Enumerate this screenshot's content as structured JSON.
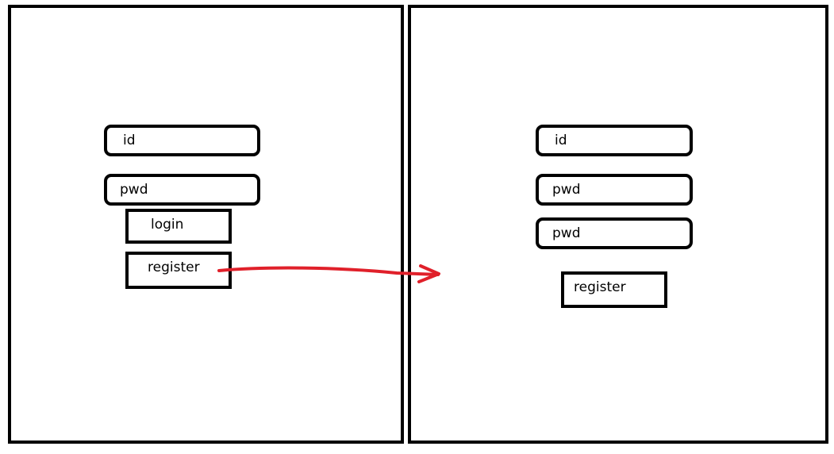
{
  "login_screen": {
    "id_field": "id",
    "pwd_field": "pwd",
    "login_button": "login",
    "register_button": "register"
  },
  "register_screen": {
    "id_field": "id",
    "pwd_field": "pwd",
    "pwd_confirm_field": "pwd",
    "register_button": "register"
  },
  "colors": {
    "border": "#000000",
    "arrow": "#e0202a",
    "background": "#ffffff"
  }
}
